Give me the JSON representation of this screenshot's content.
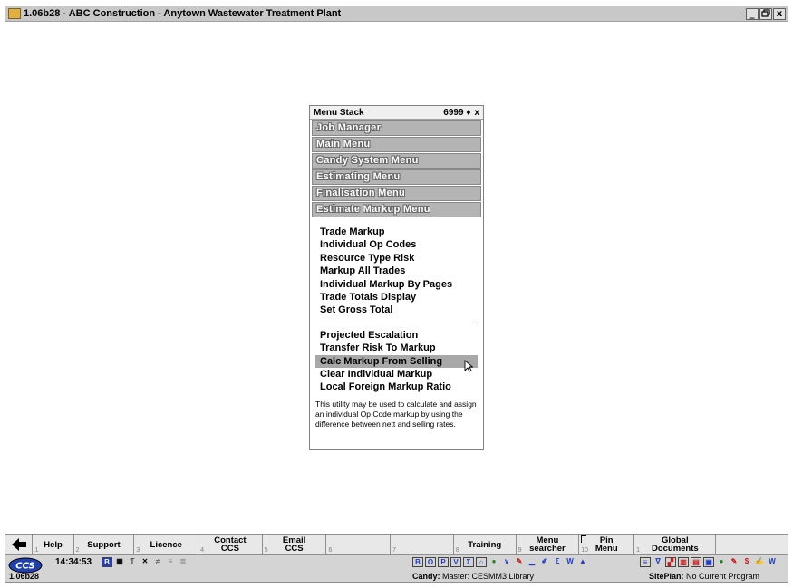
{
  "window": {
    "title": "1.06b28 - ABC Construction - Anytown Wastewater Treatment Plant",
    "controls": [
      "_",
      "̈",
      "x"
    ]
  },
  "menu_stack": {
    "title": "Menu Stack",
    "count": "6999",
    "arrows": "♦",
    "close": "x",
    "stack": [
      "Job Manager",
      "Main Menu",
      "Candy System Menu",
      "Estimating Menu",
      "Finalisation Menu",
      "Estimate Markup Menu"
    ],
    "options_group1": [
      "Trade Markup",
      "Individual Op Codes",
      "Resource Type Risk",
      "Markup All Trades",
      "Individual Markup By Pages",
      "Trade Totals Display",
      "Set Gross Total"
    ],
    "options_group2": [
      "Projected Escalation",
      "Transfer Risk To Markup",
      "Calc Markup From Selling",
      "Clear Individual Markup",
      "Local Foreign Markup Ratio"
    ],
    "selected_option": "Calc Markup From Selling",
    "description": "This utility may be used to calculate and assign an individual Op Code markup by using the difference between nett and selling rates."
  },
  "toolbar": {
    "buttons": [
      {
        "label": "Help",
        "fnum": "1"
      },
      {
        "label": "Support",
        "fnum": "2"
      },
      {
        "label": "Licence",
        "fnum": "3"
      },
      {
        "label": "Contact\nCCS",
        "fnum": "4"
      },
      {
        "label": "Email\nCCS",
        "fnum": "5"
      },
      {
        "label": "",
        "fnum": "6"
      },
      {
        "label": "",
        "fnum": "7"
      },
      {
        "label": "Training",
        "fnum": "8"
      },
      {
        "label": "Menu\nsearcher",
        "fnum": "9"
      },
      {
        "label": "Pin\nMenu",
        "fnum": "10"
      },
      {
        "label": "Global\nDocuments",
        "fnum": "1"
      },
      {
        "label": "",
        "fnum": ""
      }
    ]
  },
  "status": {
    "version": "1.06b28",
    "time": "14:34:53",
    "candy_label": "Candy:",
    "candy_value": "Master: CESMM3 Library",
    "siteplan_label": "SitePlan:",
    "siteplan_value": "No Current Program",
    "colors": {
      "blue": "#1e3cc8",
      "red": "#d01818",
      "green": "#188a18",
      "yellow": "#e8c020"
    }
  }
}
